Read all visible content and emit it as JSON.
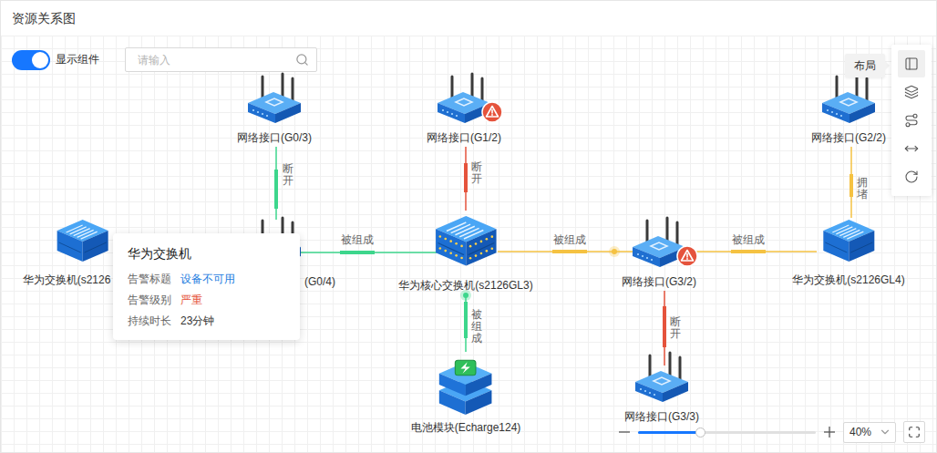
{
  "title": "资源关系图",
  "toolbar": {
    "toggle": {
      "label": "显示组件",
      "on": true
    },
    "search": {
      "placeholder": "请输入"
    }
  },
  "side_toolbar": {
    "tooltip": "布局",
    "tools": [
      {
        "selected": true
      },
      {
        "selected": false
      },
      {
        "selected": false
      },
      {
        "selected": false
      },
      {
        "selected": false
      }
    ]
  },
  "nodes": [
    {
      "label": "网络接口(G0/3)",
      "kind": "router",
      "alert": false
    },
    {
      "label": "网络接口(G1/2)",
      "kind": "router",
      "alert": true
    },
    {
      "label": "网络接口(G2/2)",
      "kind": "router",
      "alert": false
    },
    {
      "label": "华为交换机(s2126",
      "kind": "switch",
      "alert": false
    },
    {
      "label": "(G0/4)",
      "kind": "router",
      "alert": false
    },
    {
      "label": "华为核心交换机(s2126GL3)",
      "kind": "core",
      "alert": false
    },
    {
      "label": "网络接口(G3/2)",
      "kind": "router",
      "alert": true
    },
    {
      "label": "华为交换机(s2126GL4)",
      "kind": "switch",
      "alert": false
    },
    {
      "label": "电池模块(Echarge124)",
      "kind": "battery",
      "alert": false
    },
    {
      "label": "网络接口(G3/3)",
      "kind": "router",
      "alert": false
    }
  ],
  "edges": [
    {
      "label": "断开",
      "color": "#3dd68c"
    },
    {
      "label": "断开",
      "color": "#e5533c"
    },
    {
      "label": "拥堵",
      "color": "#f5c242"
    },
    {
      "label": "被组成",
      "color": "#3dd68c"
    },
    {
      "label": "被组成",
      "color": "#f5c242"
    },
    {
      "label": "被组成",
      "color": "#f5c242"
    },
    {
      "label": "被组成",
      "color": "#3dd68c"
    },
    {
      "label": "断开",
      "color": "#e5533c"
    }
  ],
  "tooltip": {
    "title": "华为交换机",
    "rows": [
      {
        "label": "告警标题",
        "value": "设备不可用",
        "color": "#1a7be0"
      },
      {
        "label": "告警级别",
        "value": "严重",
        "color": "#e5533c"
      },
      {
        "label": "持续时长",
        "value": "23分钟",
        "color": "#333333"
      }
    ]
  },
  "zoom": {
    "level": 0.35,
    "value": "40%"
  }
}
